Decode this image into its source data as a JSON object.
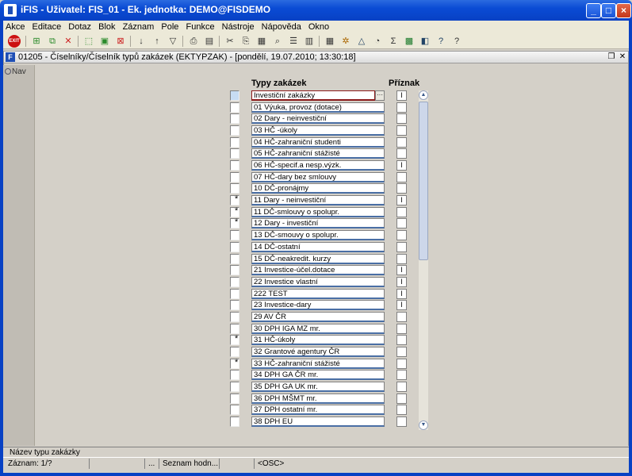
{
  "window": {
    "title": "iFIS - Uživatel: FIS_01 - Ek. jednotka: DEMO@FISDEMO"
  },
  "menu": [
    "Akce",
    "Editace",
    "Dotaz",
    "Blok",
    "Záznam",
    "Pole",
    "Funkce",
    "Nástroje",
    "Nápověda",
    "Okno"
  ],
  "child": {
    "title": "01205 - Číselníky/Číselník typů zakázek (EKTYPZAK) - [pondělí, 19.07.2010; 13:30:18]"
  },
  "nav": {
    "label": "Nav"
  },
  "columns": {
    "type": "Typy zakázek",
    "flag": "Příznak"
  },
  "rows": [
    {
      "mark": "",
      "label": "Investiční zakázky",
      "flag": "I"
    },
    {
      "mark": "",
      "label": "01 Výuka, provoz (dotace)",
      "flag": ""
    },
    {
      "mark": "",
      "label": "02 Dary - neinvestiční",
      "flag": ""
    },
    {
      "mark": "",
      "label": "03 HČ -úkoly",
      "flag": ""
    },
    {
      "mark": "",
      "label": "04 HČ-zahraniční studenti",
      "flag": ""
    },
    {
      "mark": "",
      "label": "05 HČ-zahraniční stážisté",
      "flag": ""
    },
    {
      "mark": "",
      "label": "06 HČ-specif.a nesp.výzk.",
      "flag": "I"
    },
    {
      "mark": "",
      "label": "07 HČ-dary bez smlouvy",
      "flag": ""
    },
    {
      "mark": "",
      "label": "10 DČ-pronájmy",
      "flag": ""
    },
    {
      "mark": "*",
      "label": "11 Dary - neinvestiční",
      "flag": "I"
    },
    {
      "mark": "*",
      "label": "11 DČ-smlouvy o spolupr.",
      "flag": ""
    },
    {
      "mark": "*",
      "label": "12 Dary - investiční",
      "flag": ""
    },
    {
      "mark": "",
      "label": "13 DČ-smouvy o spolupr.",
      "flag": ""
    },
    {
      "mark": "",
      "label": "14 DČ-ostatní",
      "flag": ""
    },
    {
      "mark": "",
      "label": "15 DČ-neakredit. kurzy",
      "flag": ""
    },
    {
      "mark": "",
      "label": "21 Investice-účel.dotace",
      "flag": "I"
    },
    {
      "mark": "",
      "label": "22 Investice vlastní",
      "flag": "I"
    },
    {
      "mark": "",
      "label": "222 TEST",
      "flag": "I"
    },
    {
      "mark": "",
      "label": "23 Investice-dary",
      "flag": "I"
    },
    {
      "mark": "",
      "label": "29 AV ČR",
      "flag": ""
    },
    {
      "mark": "",
      "label": "30 DPH IGA MZ mr.",
      "flag": ""
    },
    {
      "mark": "*",
      "label": "31 HČ-úkoly",
      "flag": ""
    },
    {
      "mark": "",
      "label": "32 Grantové agentury ČR",
      "flag": ""
    },
    {
      "mark": "*",
      "label": "33 HČ-zahraniční stážisté",
      "flag": ""
    },
    {
      "mark": "",
      "label": "34 DPH GA ČR mr.",
      "flag": ""
    },
    {
      "mark": "",
      "label": "35 DPH GA UK mr.",
      "flag": ""
    },
    {
      "mark": "",
      "label": "36 DPH MŠMT mr.",
      "flag": ""
    },
    {
      "mark": "",
      "label": "37 DPH ostatní mr.",
      "flag": ""
    },
    {
      "mark": "",
      "label": "38 DPH EU",
      "flag": ""
    }
  ],
  "hint": "Název typu zakázky",
  "status": {
    "record": "Záznam: 1/?",
    "dots": "...",
    "list": "Seznam hodn...",
    "osc": "<OSC>"
  }
}
